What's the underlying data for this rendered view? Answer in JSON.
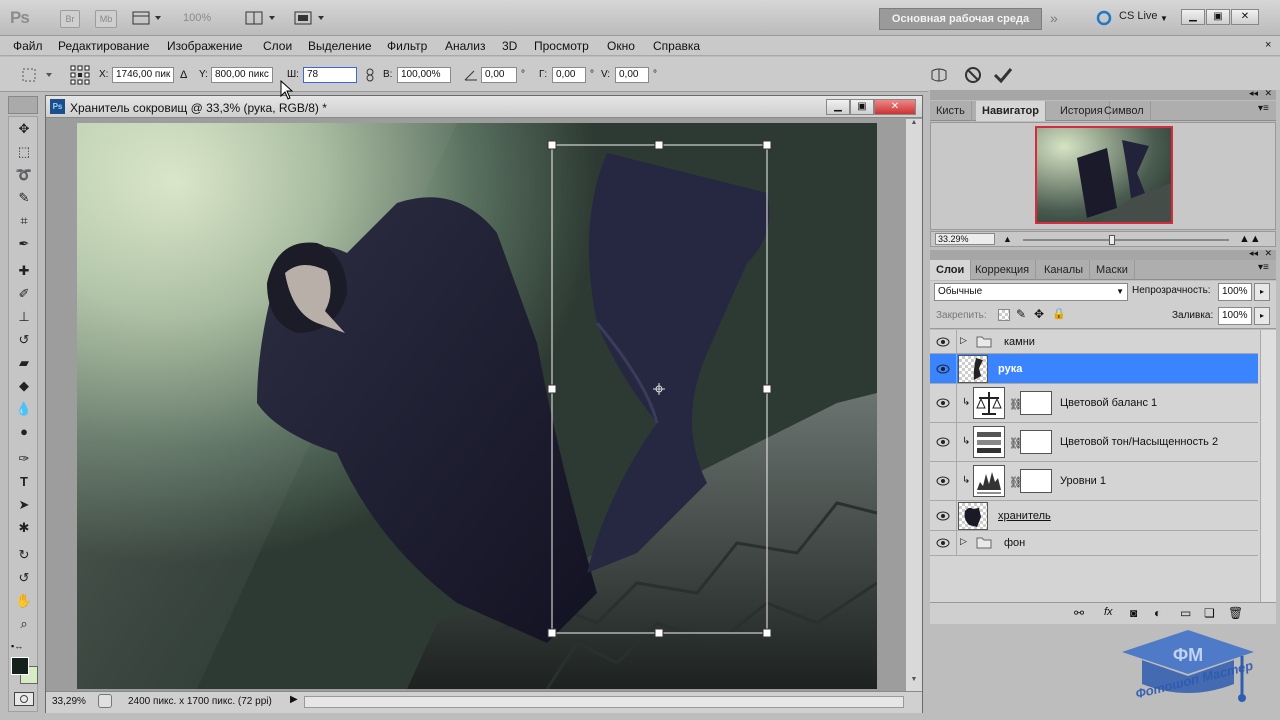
{
  "app": {
    "logo": "Ps",
    "icon_br": "Br",
    "icon_mb": "Mb",
    "zoom_level": "100%",
    "workspace": "Основная рабочая среда",
    "cslive": "CS Live"
  },
  "menu": [
    "Файл",
    "Редактирование",
    "Изображение",
    "Слои",
    "Выделение",
    "Фильтр",
    "Анализ",
    "3D",
    "Просмотр",
    "Окно",
    "Справка"
  ],
  "options": {
    "x_label": "X:",
    "x_value": "1746,00 пик",
    "y_label": "Y:",
    "y_value": "800,00 пикс",
    "w_label": "Ш:",
    "w_value": "78",
    "h_label": "В:",
    "h_value": "100,00%",
    "angle_value": "0,00",
    "angle_unit": "°",
    "hskew_label": "Г:",
    "hskew_value": "0,00",
    "vskew_label": "V:",
    "vskew_value": "0,00"
  },
  "document": {
    "title": "Хранитель сокровищ @ 33,3% (рука, RGB/8) *",
    "zoom": "33,29%",
    "info": "2400 пикс. x 1700 пикс. (72 ppi)"
  },
  "navigator": {
    "tabs": [
      "Кисть",
      "Навигатор",
      "История",
      "Символ"
    ],
    "active_tab": "Навигатор",
    "zoom": "33.29%",
    "zoom_slider_fraction": 0.43
  },
  "layers_panel": {
    "tabs": [
      "Слои",
      "Коррекция",
      "Каналы",
      "Маски"
    ],
    "active_tab": "Слои",
    "blend_mode": "Обычные",
    "opacity_label": "Непрозрачность:",
    "opacity": "100%",
    "lock_label": "Закрепить:",
    "fill_label": "Заливка:",
    "fill": "100%",
    "layers": [
      {
        "name": "камни"
      },
      {
        "name": "рука"
      },
      {
        "name": "Цветовой баланс 1"
      },
      {
        "name": "Цветовой тон/Насыщенность 2"
      },
      {
        "name": "Уровни 1"
      },
      {
        "name": "хранитель"
      },
      {
        "name": "фон"
      }
    ]
  },
  "watermark": "Фотошоп Мастер",
  "colors": {
    "selection_blue": "#3b84ff",
    "workspace_button": "#9a9a9a"
  }
}
